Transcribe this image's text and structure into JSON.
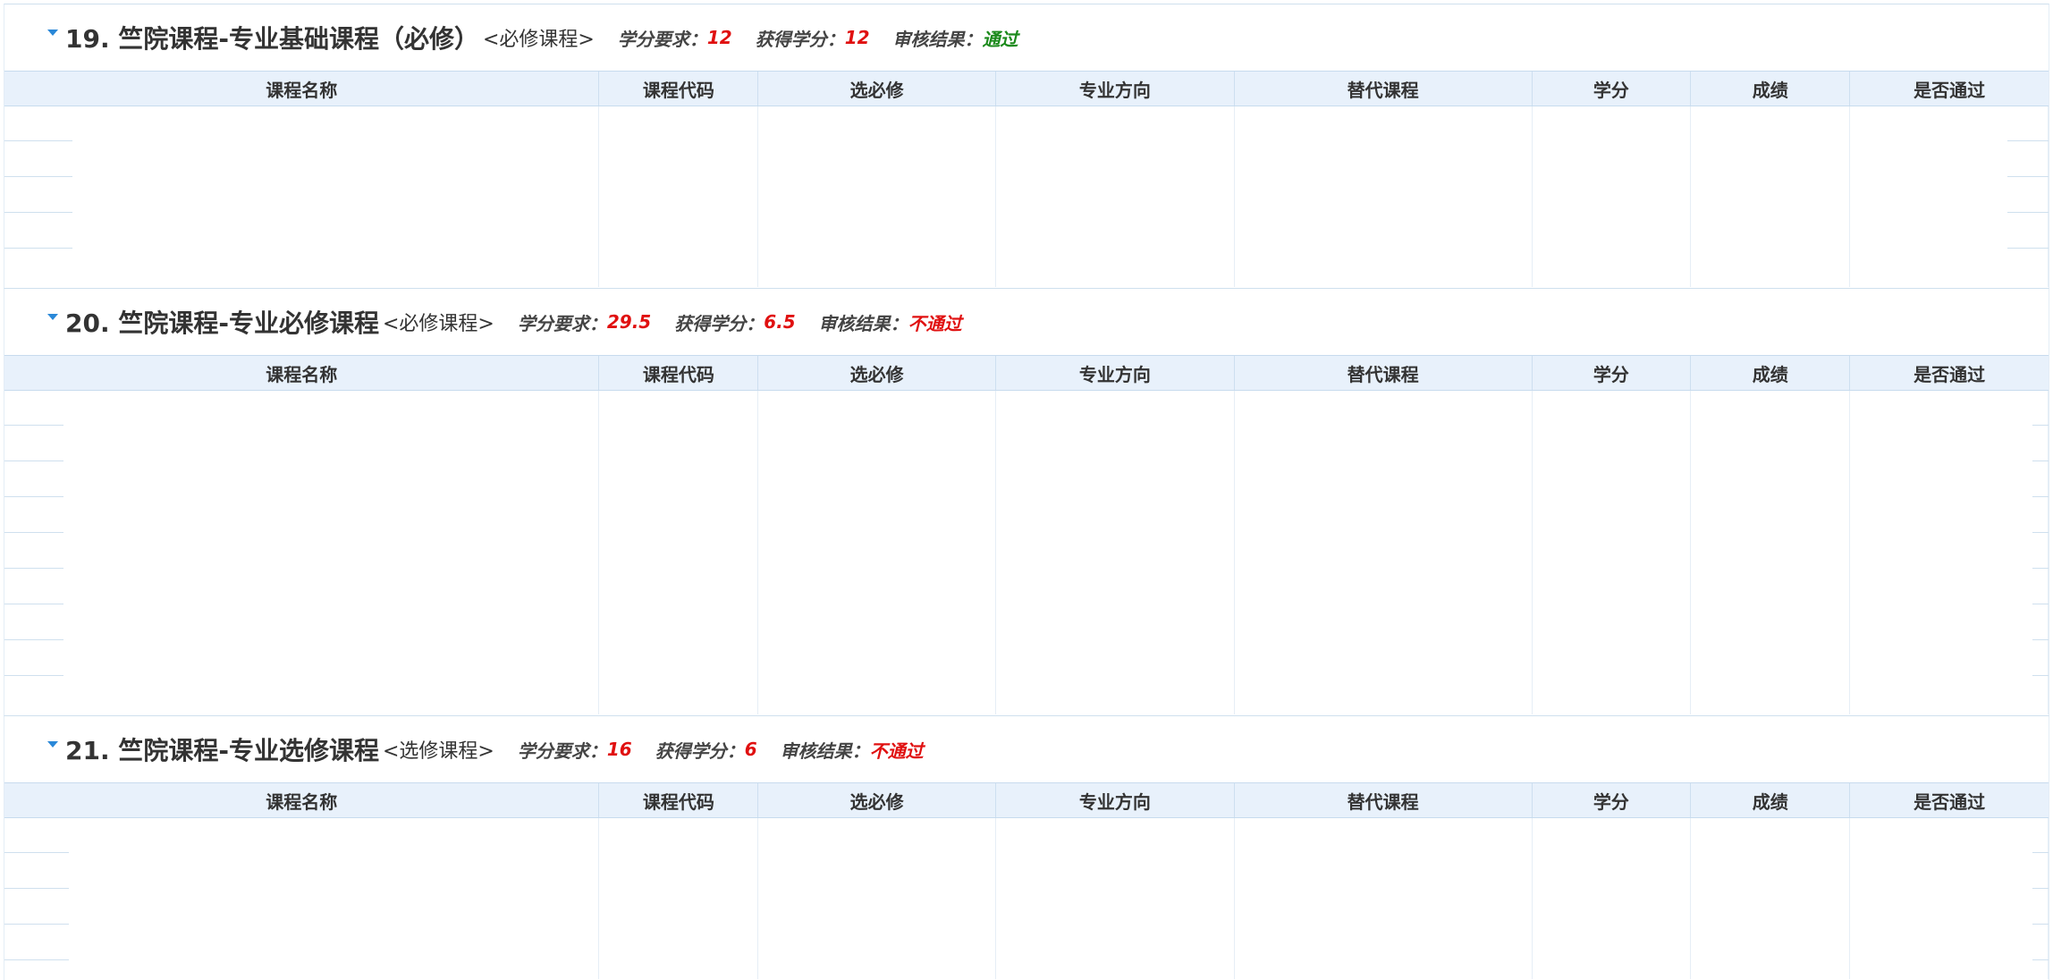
{
  "columns": [
    "课程名称",
    "课程代码",
    "选必修",
    "专业方向",
    "替代课程",
    "学分",
    "成绩",
    "是否通过"
  ],
  "labels": {
    "required_credits": "学分要求：",
    "earned_credits": "获得学分：",
    "review_result": "审核结果："
  },
  "sections": [
    {
      "title": "19. 竺院课程-专业基础课程（必修）",
      "type": "<必修课程>",
      "required_credits": "12",
      "earned_credits": "12",
      "result": "通过",
      "result_status": "pass"
    },
    {
      "title": "20. 竺院课程-专业必修课程",
      "type": "<必修课程>",
      "required_credits": "29.5",
      "earned_credits": "6.5",
      "result": "不通过",
      "result_status": "fail"
    },
    {
      "title": "21. 竺院课程-专业选修课程",
      "type": "<选修课程>",
      "required_credits": "16",
      "earned_credits": "6",
      "result": "不通过",
      "result_status": "fail"
    }
  ],
  "colors": {
    "header_bg": "#e8f1fb",
    "pass": "#1b8a1b",
    "fail": "#e01010",
    "accent": "#2a88d8"
  }
}
